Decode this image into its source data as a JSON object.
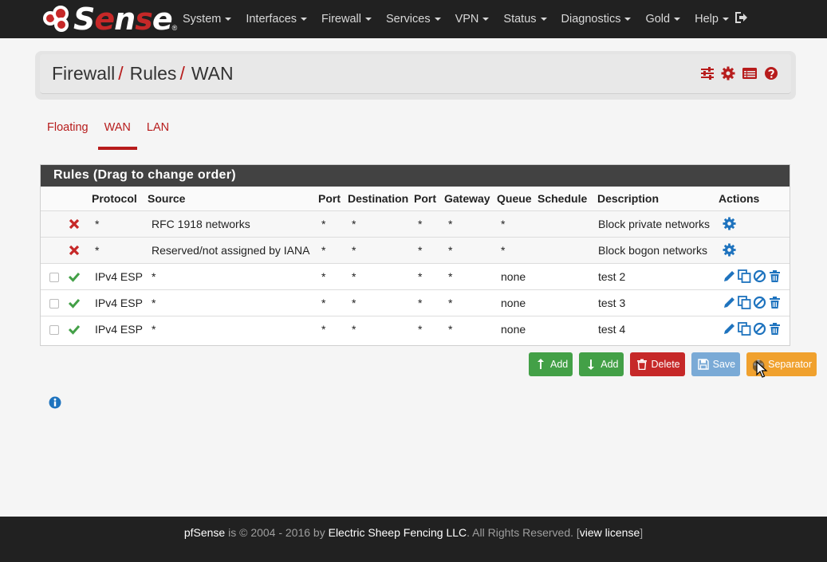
{
  "nav": {
    "logo_text": "Sense",
    "logo_reg": "®",
    "menu": [
      "System",
      "Interfaces",
      "Firewall",
      "Services",
      "VPN",
      "Status",
      "Diagnostics",
      "Gold",
      "Help"
    ]
  },
  "breadcrumb": {
    "part1": "Firewall",
    "part2": "Rules",
    "part3": "WAN",
    "sep": "/"
  },
  "tabs": [
    "Floating",
    "WAN",
    "LAN"
  ],
  "panel": {
    "title": "Rules (Drag to change order)",
    "headers": [
      "Protocol",
      "Source",
      "Port",
      "Destination",
      "Port",
      "Gateway",
      "Queue",
      "Schedule",
      "Description",
      "Actions"
    ],
    "rows": [
      {
        "protocol": "*",
        "source": "RFC 1918 networks",
        "port": "*",
        "destination": "*",
        "dport": "*",
        "gateway": "*",
        "queue": "*",
        "schedule": "",
        "description": "Block private networks"
      },
      {
        "protocol": "*",
        "source": "Reserved/not assigned by IANA",
        "port": "*",
        "destination": "*",
        "dport": "*",
        "gateway": "*",
        "queue": "*",
        "schedule": "",
        "description": "Block bogon networks"
      },
      {
        "protocol": "IPv4 ESP",
        "source": "*",
        "port": "*",
        "destination": "*",
        "dport": "*",
        "gateway": "*",
        "queue": "none",
        "schedule": "",
        "description": "test 2"
      },
      {
        "protocol": "IPv4 ESP",
        "source": "*",
        "port": "*",
        "destination": "*",
        "dport": "*",
        "gateway": "*",
        "queue": "none",
        "schedule": "",
        "description": "test 3"
      },
      {
        "protocol": "IPv4 ESP",
        "source": "*",
        "port": "*",
        "destination": "*",
        "dport": "*",
        "gateway": "*",
        "queue": "none",
        "schedule": "",
        "description": "test 4"
      }
    ]
  },
  "buttons": {
    "add_top": "Add",
    "add_bottom": "Add",
    "delete": "Delete",
    "save": "Save",
    "separator": "Separator"
  },
  "footer": {
    "brand": "pfSense",
    "text1": " is © 2004 - 2016 by ",
    "company": "Electric Sheep Fencing LLC",
    "text2": ". All Rights Reserved. [",
    "license": "view license",
    "text3": "]"
  },
  "colors": {
    "accent": "#b71c1c",
    "navbar": "#212121",
    "pass": "#43a047",
    "block": "#c62828",
    "action_blue": "#1e73be"
  }
}
